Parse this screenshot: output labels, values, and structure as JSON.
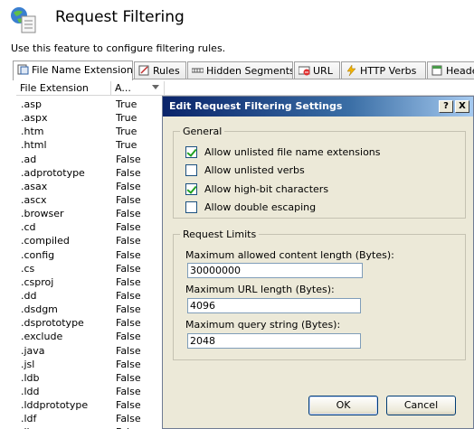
{
  "header": {
    "title": "Request Filtering",
    "description": "Use this feature to configure filtering rules."
  },
  "tabs": [
    {
      "label": "File Name Extensions",
      "icon": "file-extensions-icon"
    },
    {
      "label": "Rules",
      "icon": "rules-icon"
    },
    {
      "label": "Hidden Segments",
      "icon": "hidden-segments-icon"
    },
    {
      "label": "URL",
      "icon": "url-icon"
    },
    {
      "label": "HTTP Verbs",
      "icon": "http-verbs-icon"
    },
    {
      "label": "Heade",
      "icon": "headers-icon"
    }
  ],
  "table": {
    "columns": [
      "File Extension",
      "A..."
    ],
    "rows": [
      {
        "ext": ".asp",
        "allowed": "True"
      },
      {
        "ext": ".aspx",
        "allowed": "True"
      },
      {
        "ext": ".htm",
        "allowed": "True"
      },
      {
        "ext": ".html",
        "allowed": "True"
      },
      {
        "ext": ".ad",
        "allowed": "False"
      },
      {
        "ext": ".adprototype",
        "allowed": "False"
      },
      {
        "ext": ".asax",
        "allowed": "False"
      },
      {
        "ext": ".ascx",
        "allowed": "False"
      },
      {
        "ext": ".browser",
        "allowed": "False"
      },
      {
        "ext": ".cd",
        "allowed": "False"
      },
      {
        "ext": ".compiled",
        "allowed": "False"
      },
      {
        "ext": ".config",
        "allowed": "False"
      },
      {
        "ext": ".cs",
        "allowed": "False"
      },
      {
        "ext": ".csproj",
        "allowed": "False"
      },
      {
        "ext": ".dd",
        "allowed": "False"
      },
      {
        "ext": ".dsdgm",
        "allowed": "False"
      },
      {
        "ext": ".dsprototype",
        "allowed": "False"
      },
      {
        "ext": ".exclude",
        "allowed": "False"
      },
      {
        "ext": ".java",
        "allowed": "False"
      },
      {
        "ext": ".jsl",
        "allowed": "False"
      },
      {
        "ext": ".ldb",
        "allowed": "False"
      },
      {
        "ext": ".ldd",
        "allowed": "False"
      },
      {
        "ext": ".lddprototype",
        "allowed": "False"
      },
      {
        "ext": ".ldf",
        "allowed": "False"
      },
      {
        "ext": ".licx",
        "allowed": "False"
      }
    ]
  },
  "dialog": {
    "title": "Edit Request Filtering Settings",
    "help_label": "?",
    "close_label": "X",
    "general": {
      "label": "General",
      "options": [
        {
          "label": "Allow unlisted file name extensions",
          "checked": true
        },
        {
          "label": "Allow unlisted verbs",
          "checked": false
        },
        {
          "label": "Allow high-bit characters",
          "checked": true
        },
        {
          "label": "Allow double escaping",
          "checked": false
        }
      ]
    },
    "limits": {
      "label": "Request Limits",
      "content_length_label": "Maximum allowed content length (Bytes):",
      "content_length_value": "30000000",
      "url_length_label": "Maximum URL length (Bytes):",
      "url_length_value": "4096",
      "query_string_label": "Maximum query string (Bytes):",
      "query_string_value": "2048"
    },
    "ok_label": "OK",
    "cancel_label": "Cancel"
  }
}
